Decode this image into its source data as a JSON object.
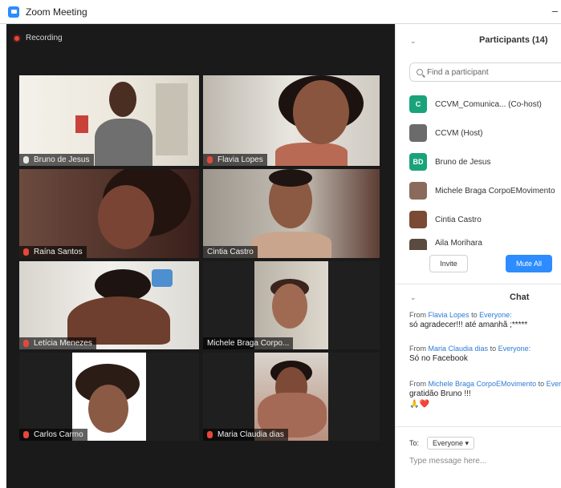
{
  "window": {
    "title": "Zoom Meeting",
    "minimize": "–"
  },
  "video": {
    "recording_label": "Recording",
    "tiles": [
      {
        "name": "Bruno de Jesus"
      },
      {
        "name": "Flavia Lopes"
      },
      {
        "name": "Raína Santos"
      },
      {
        "name": "Cintia Castro"
      },
      {
        "name": "Letícia Menezes"
      },
      {
        "name": "Michele Braga Corpo..."
      },
      {
        "name": "Carlos Carmo"
      },
      {
        "name": "Maria Claudia dias"
      }
    ]
  },
  "participants": {
    "title": "Participants (14)",
    "search_placeholder": "Find a participant",
    "list": [
      {
        "initials": "C",
        "name": "CCVM_Comunica...  (Co-host)",
        "color": "#1aa37a"
      },
      {
        "initials": "",
        "name": "CCVM (Host)",
        "color": "#6b6b6b"
      },
      {
        "initials": "BD",
        "name": "Bruno de Jesus",
        "color": "#1aa37a"
      },
      {
        "initials": "",
        "name": "Michele Braga CorpoEMovimento",
        "color": "#8a6a5a"
      },
      {
        "initials": "",
        "name": "Cintia Castro",
        "color": "#7a4a35"
      },
      {
        "initials": "",
        "name": "Aila Morihara",
        "color": "#5a4a40"
      }
    ],
    "invite_label": "Invite",
    "mute_all_label": "Mute All"
  },
  "chat": {
    "title": "Chat",
    "messages": [
      {
        "from_prefix": "From",
        "sender": "Flavia Lopes",
        "to_word": "to",
        "recipient": "Everyone:",
        "text": "só agradecer!!! até amanhã ;*****"
      },
      {
        "from_prefix": "From",
        "sender": "Maria Claudia dias",
        "to_word": "to",
        "recipient": "Everyone:",
        "text": "Só no Facebook"
      },
      {
        "from_prefix": "From",
        "sender": "Michele Braga CorpoEMovimento",
        "to_word": "to",
        "recipient": "Everyone:",
        "text": "gratidão Bruno !!!",
        "emoji": "🙏❤️"
      }
    ],
    "to_label": "To:",
    "to_value": "Everyone ▾",
    "input_placeholder": "Type message here..."
  }
}
